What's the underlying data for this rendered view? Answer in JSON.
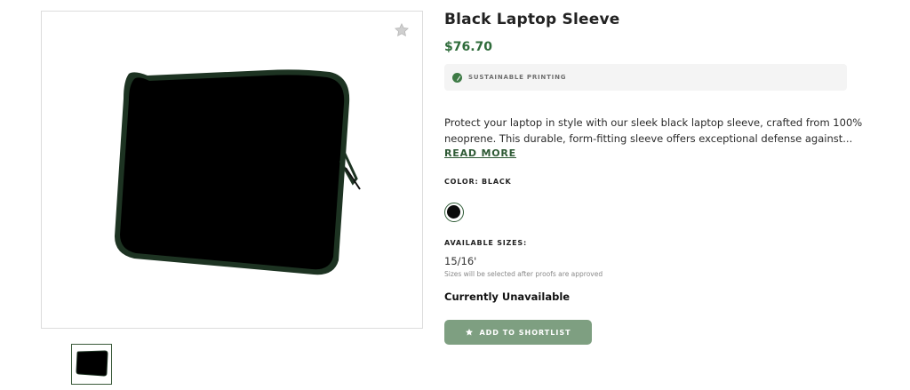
{
  "product": {
    "title": "Black Laptop Sleeve",
    "price": "$76.70",
    "badge": {
      "icon": "leaf-icon",
      "text": "SUSTAINABLE PRINTING"
    },
    "description_lines": [
      "Protect your laptop in style with our sleek black laptop sleeve, crafted from 100%",
      "neoprene. This durable, form-fitting sleeve offers exceptional defense against..."
    ],
    "read_more": "READ MORE",
    "color_label": "COLOR: BLACK",
    "color_swatch": "#0b0b0b",
    "sizes_label": "AVAILABLE SIZES:",
    "size_value": "15/16'",
    "size_note": "Sizes will be selected after proofs are approved",
    "availability": "Currently Unavailable",
    "shortlist_button": "ADD TO SHORTLIST"
  },
  "gallery": {
    "favorite_icon": "star-icon",
    "thumbnails": 1
  },
  "colors": {
    "accent": "#2e6b3a",
    "button": "#7e9f81",
    "sleeve_trim": "#1d3322"
  }
}
